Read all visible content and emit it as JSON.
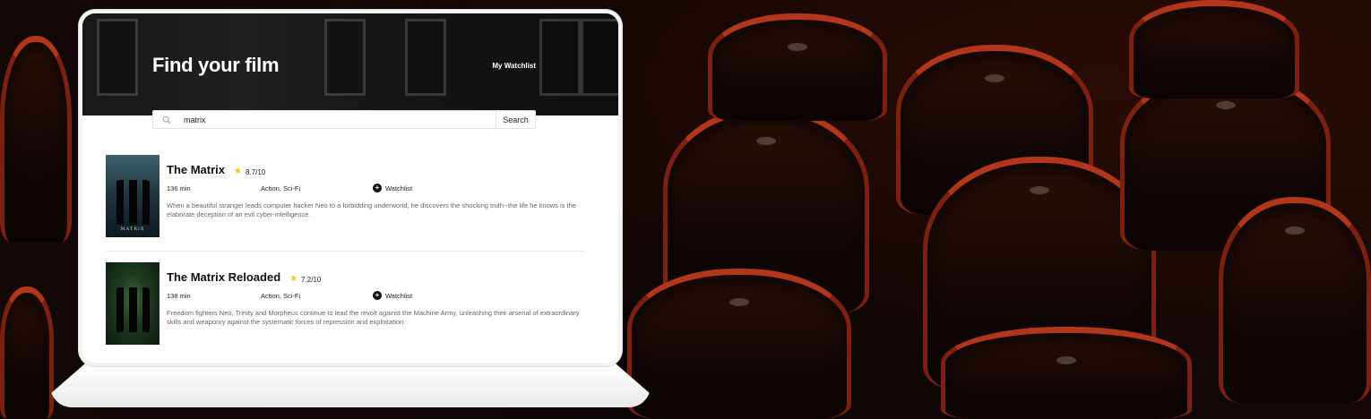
{
  "app": {
    "heading": "Find your film",
    "nav_watchlist": "My Watchlist"
  },
  "search": {
    "value": "matrix",
    "button_label": "Search"
  },
  "results": [
    {
      "title": "The Matrix",
      "rating": "8.7/10",
      "runtime": "136 min",
      "genres": "Action, Sci-Fi",
      "watchlist_label": "Watchlist",
      "plot": "When a beautiful stranger leads computer hacker Neo to a forbidding underworld, he discovers the shocking truth--the life he knows is the elaborate deception of an evil cyber-intelligence."
    },
    {
      "title": "The Matrix Reloaded",
      "rating": "7.2/10",
      "runtime": "138 min",
      "genres": "Action, Sci-Fi",
      "watchlist_label": "Watchlist",
      "plot": "Freedom fighters Neo, Trinity and Morpheus continue to lead the revolt against the Machine Army, unleashing their arsenal of extraordinary skills and weaponry against the systematic forces of repression and exploitation."
    }
  ],
  "poster_text": {
    "first": "MATRIX"
  },
  "icons": {
    "search": "search-icon",
    "star": "star-icon",
    "add": "plus-circle-icon"
  },
  "colors": {
    "star": "#f5c518",
    "seat_red": "#b2361c"
  }
}
